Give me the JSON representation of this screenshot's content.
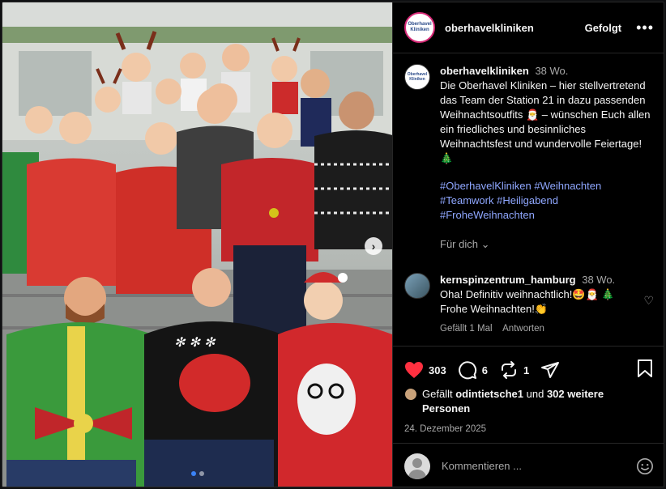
{
  "header": {
    "username": "oberhavelkliniken",
    "follow_label": "Gefolgt",
    "more_label": "•••",
    "logo_text": "Oberhavel Kliniken"
  },
  "caption": {
    "username": "oberhavelkliniken",
    "ago": "38 Wo.",
    "text": "Die Oberhavel Kliniken – hier stellvertretend das Team der Station 21 in dazu passenden Weihnachtsoutfits 🎅 – wünschen Euch allen ein friedliches und besinnliches Weihnachtsfest und wundervolle Feiertage! 🎄",
    "hashtags": [
      "#OberhavelKliniken",
      "#Weihnachten",
      "#Teamwork",
      "#Heiligabend",
      "#FroheWeihnachten"
    ],
    "translate_label": "Für dich ⌄"
  },
  "comment": {
    "username": "kernspinzentrum_hamburg",
    "ago": "38 Wo.",
    "text": "Oha! Definitiv weihnachtlich!🤩🎅 🎄 Frohe Weihnachten!👏",
    "likes": "Gefällt 1 Mal",
    "reply": "Antworten"
  },
  "actions": {
    "like_count": "303",
    "comment_count": "6",
    "repost_count": "1"
  },
  "likes": {
    "prefix": "Gefällt",
    "user": "odintietsche1",
    "mid": "und",
    "rest": "302 weitere Personen"
  },
  "date": "24. Dezember 2025",
  "comment_input": {
    "placeholder": "Kommentieren ..."
  },
  "colors": {
    "like_red": "#ff3040",
    "hashtag_blue": "#8fa7ff",
    "background": "#000000"
  }
}
